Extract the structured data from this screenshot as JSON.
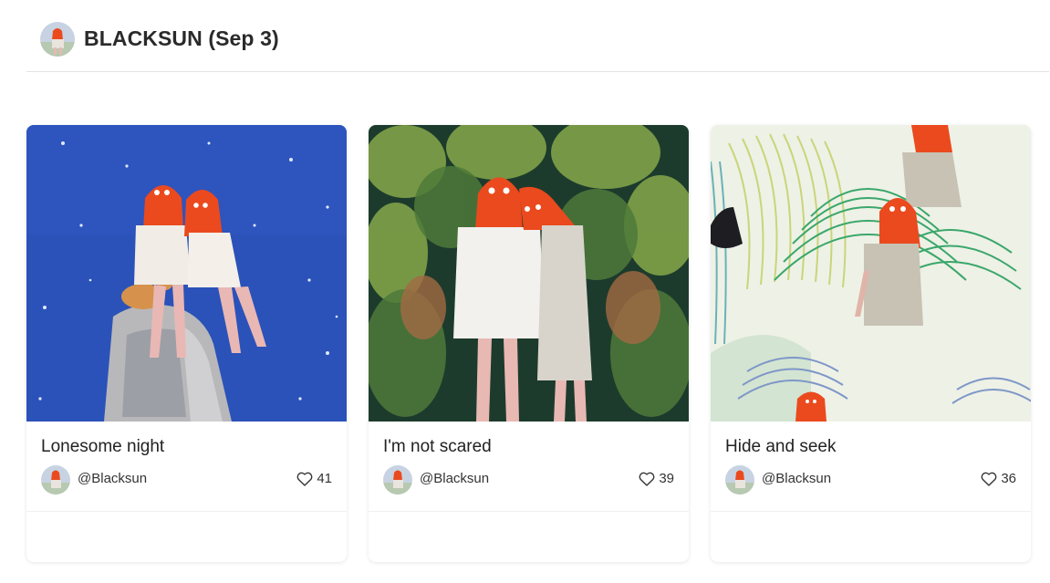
{
  "header": {
    "title": "BLACKSUN (Sep 3)"
  },
  "cards": [
    {
      "title": "Lonesome night",
      "author": "@Blacksun",
      "likes": "41"
    },
    {
      "title": "I'm not scared",
      "author": "@Blacksun",
      "likes": "39"
    },
    {
      "title": "Hide and seek",
      "author": "@Blacksun",
      "likes": "36"
    }
  ],
  "icons": {
    "like": "heart-outline-icon"
  },
  "colors": {
    "mask_orange": "#ea4a1e",
    "night_blue": "#2a53b8",
    "forest_green": "#1f4a32"
  }
}
